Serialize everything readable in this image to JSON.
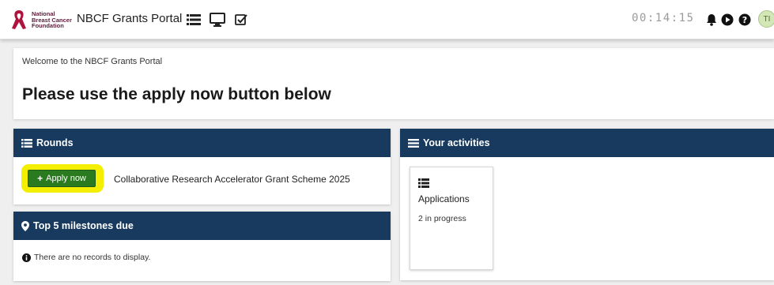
{
  "header": {
    "logo_text": [
      "National",
      "Breast Cancer",
      "Foundation"
    ],
    "app_title": "NBCF Grants Portal",
    "timer": "00:14:15",
    "avatar_initials": "TI",
    "icons": [
      "list-icon",
      "monitor-icon",
      "checkbox-icon",
      "bell-icon",
      "play-circle-icon",
      "help-icon"
    ]
  },
  "welcome": {
    "subtitle": "Welcome to the NBCF Grants Portal",
    "heading": "Please use the apply now button below"
  },
  "rounds": {
    "title": "Rounds",
    "apply_label": "Apply now",
    "round_name": "Collaborative Research Accelerator Grant Scheme 2025"
  },
  "milestones": {
    "title": "Top 5 milestones due",
    "empty_message": "There are no records to display."
  },
  "activities": {
    "title": "Your activities",
    "card": {
      "title": "Applications",
      "count": "2 in progress"
    }
  },
  "colors": {
    "panel_header": "#173a5e",
    "apply_button": "#2a7a1f",
    "highlight": "#f4ee00",
    "brand": "#b0123e",
    "background": "#efefef"
  }
}
